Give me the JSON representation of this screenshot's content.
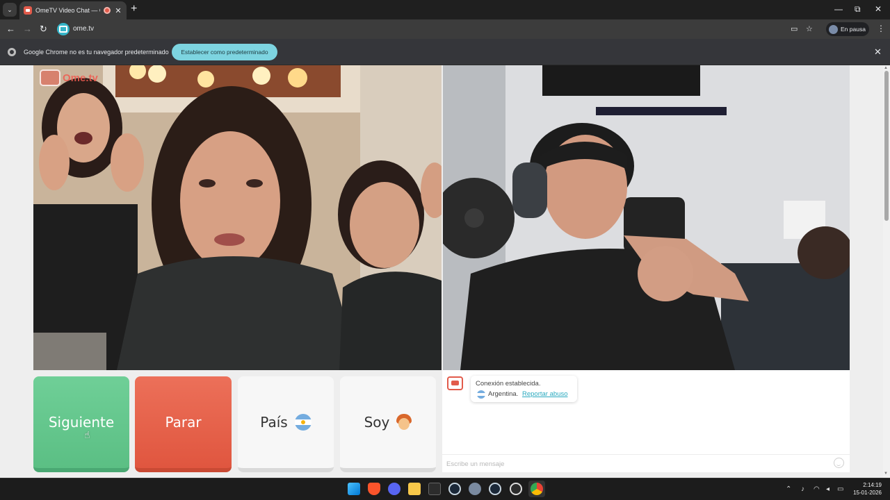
{
  "browser": {
    "tab": {
      "title": "OmeTV Video Chat — Ome",
      "close": "✕"
    },
    "new_tab": "+",
    "window_controls": {
      "minimize": "—",
      "restore": "⧉",
      "close": "✕"
    },
    "nav": {
      "back": "←",
      "forward": "→",
      "reload": "↻"
    },
    "url": "ome.tv",
    "profile_label": "En pausa",
    "menu": "⋮"
  },
  "infobar": {
    "message": "Google Chrome no es tu navegador predeterminado",
    "button": "Establecer como predeterminado",
    "close": "✕"
  },
  "page": {
    "logo_text": "Ome.tv",
    "buttons": {
      "next": "Siguiente",
      "stop": "Parar",
      "country": "País",
      "gender": "Soy"
    },
    "chat": {
      "status": "Conexión establecida.",
      "country": "Argentina.",
      "report_link": "Reportar abuso",
      "input_placeholder": "Escribe un mensaje"
    }
  },
  "taskbar": {
    "time": "2:14:19",
    "date": "15-01-2026"
  },
  "colors": {
    "next": "#5bbf84",
    "stop": "#e0563f",
    "accent": "#2aa9bf"
  }
}
